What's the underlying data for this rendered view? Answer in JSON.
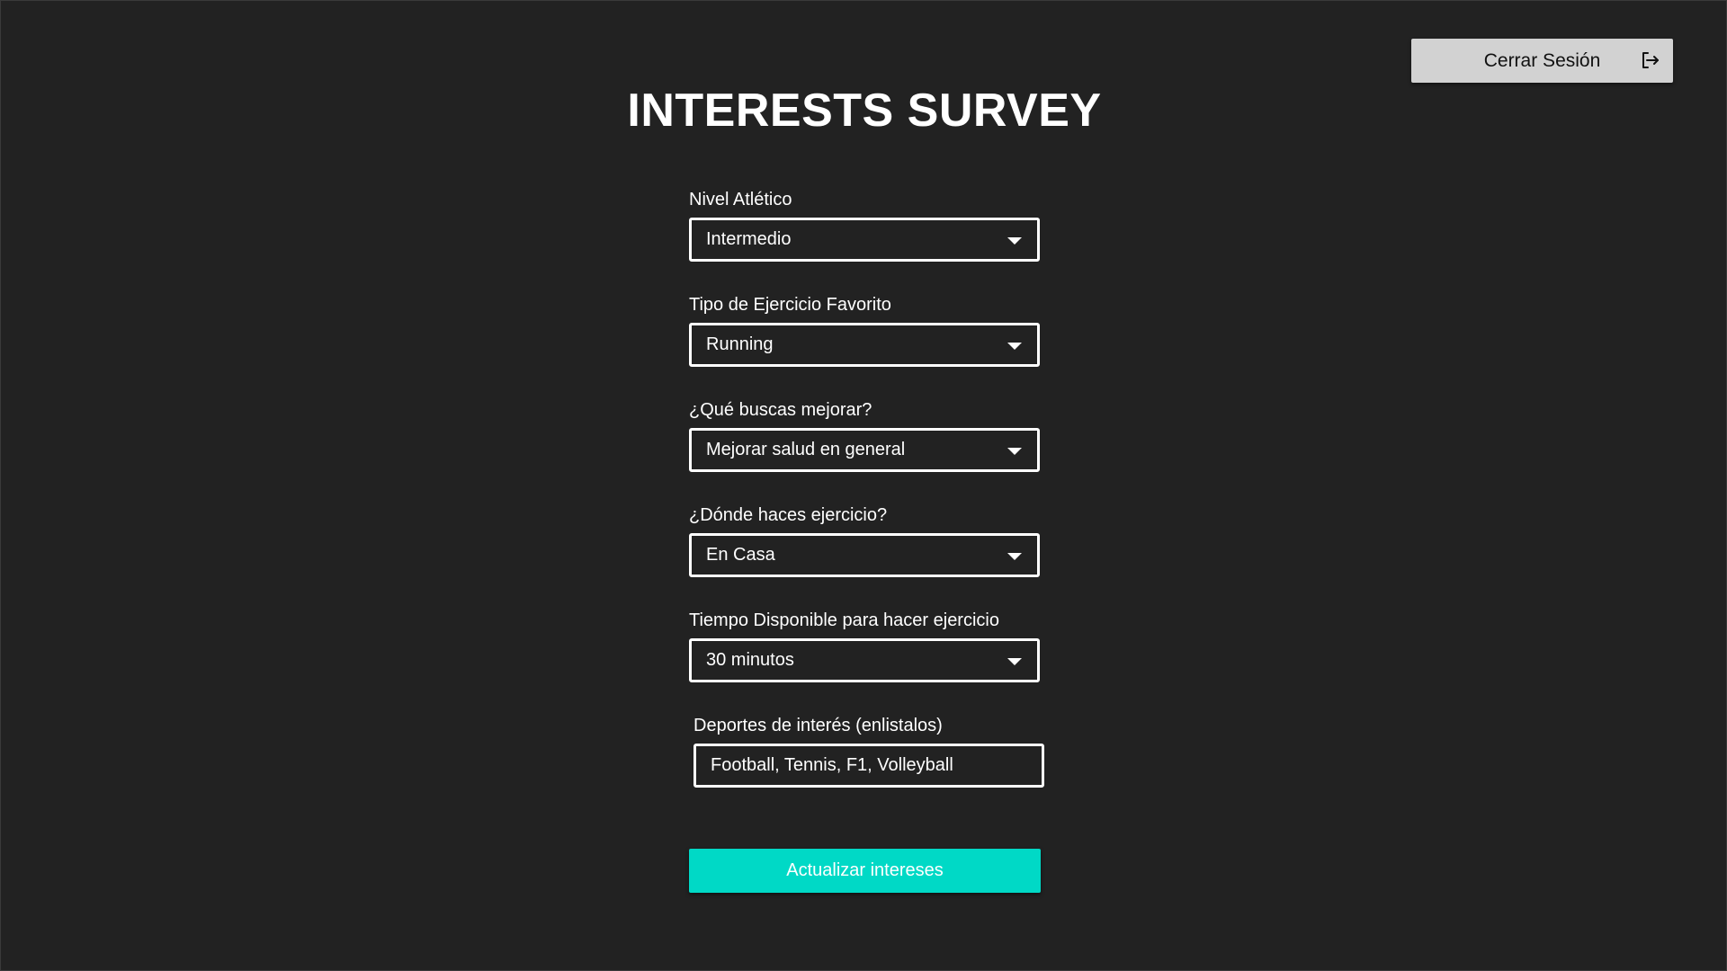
{
  "header": {
    "logout_label": "Cerrar Sesión",
    "logout_icon": "logout-icon"
  },
  "title": "INTERESTS SURVEY",
  "form": {
    "athletic_level": {
      "label": "Nivel Atlético",
      "value": "Intermedio"
    },
    "favorite_exercise": {
      "label": "Tipo de Ejercicio Favorito",
      "value": "Running"
    },
    "improvement_goal": {
      "label": "¿Qué buscas mejorar?",
      "value": "Mejorar salud en general"
    },
    "exercise_location": {
      "label": "¿Dónde haces ejercicio?",
      "value": "En Casa"
    },
    "available_time": {
      "label": "Tiempo Disponible para hacer ejercicio",
      "value": "30 minutos"
    },
    "sports": {
      "label": "Deportes de interés (enlistalos)",
      "value": "Football, Tennis, F1, Volleyball"
    },
    "submit_label": "Actualizar intereses"
  },
  "colors": {
    "background": "#222222",
    "accent": "#00d9c6",
    "logout_button": "#d2d2d2"
  }
}
